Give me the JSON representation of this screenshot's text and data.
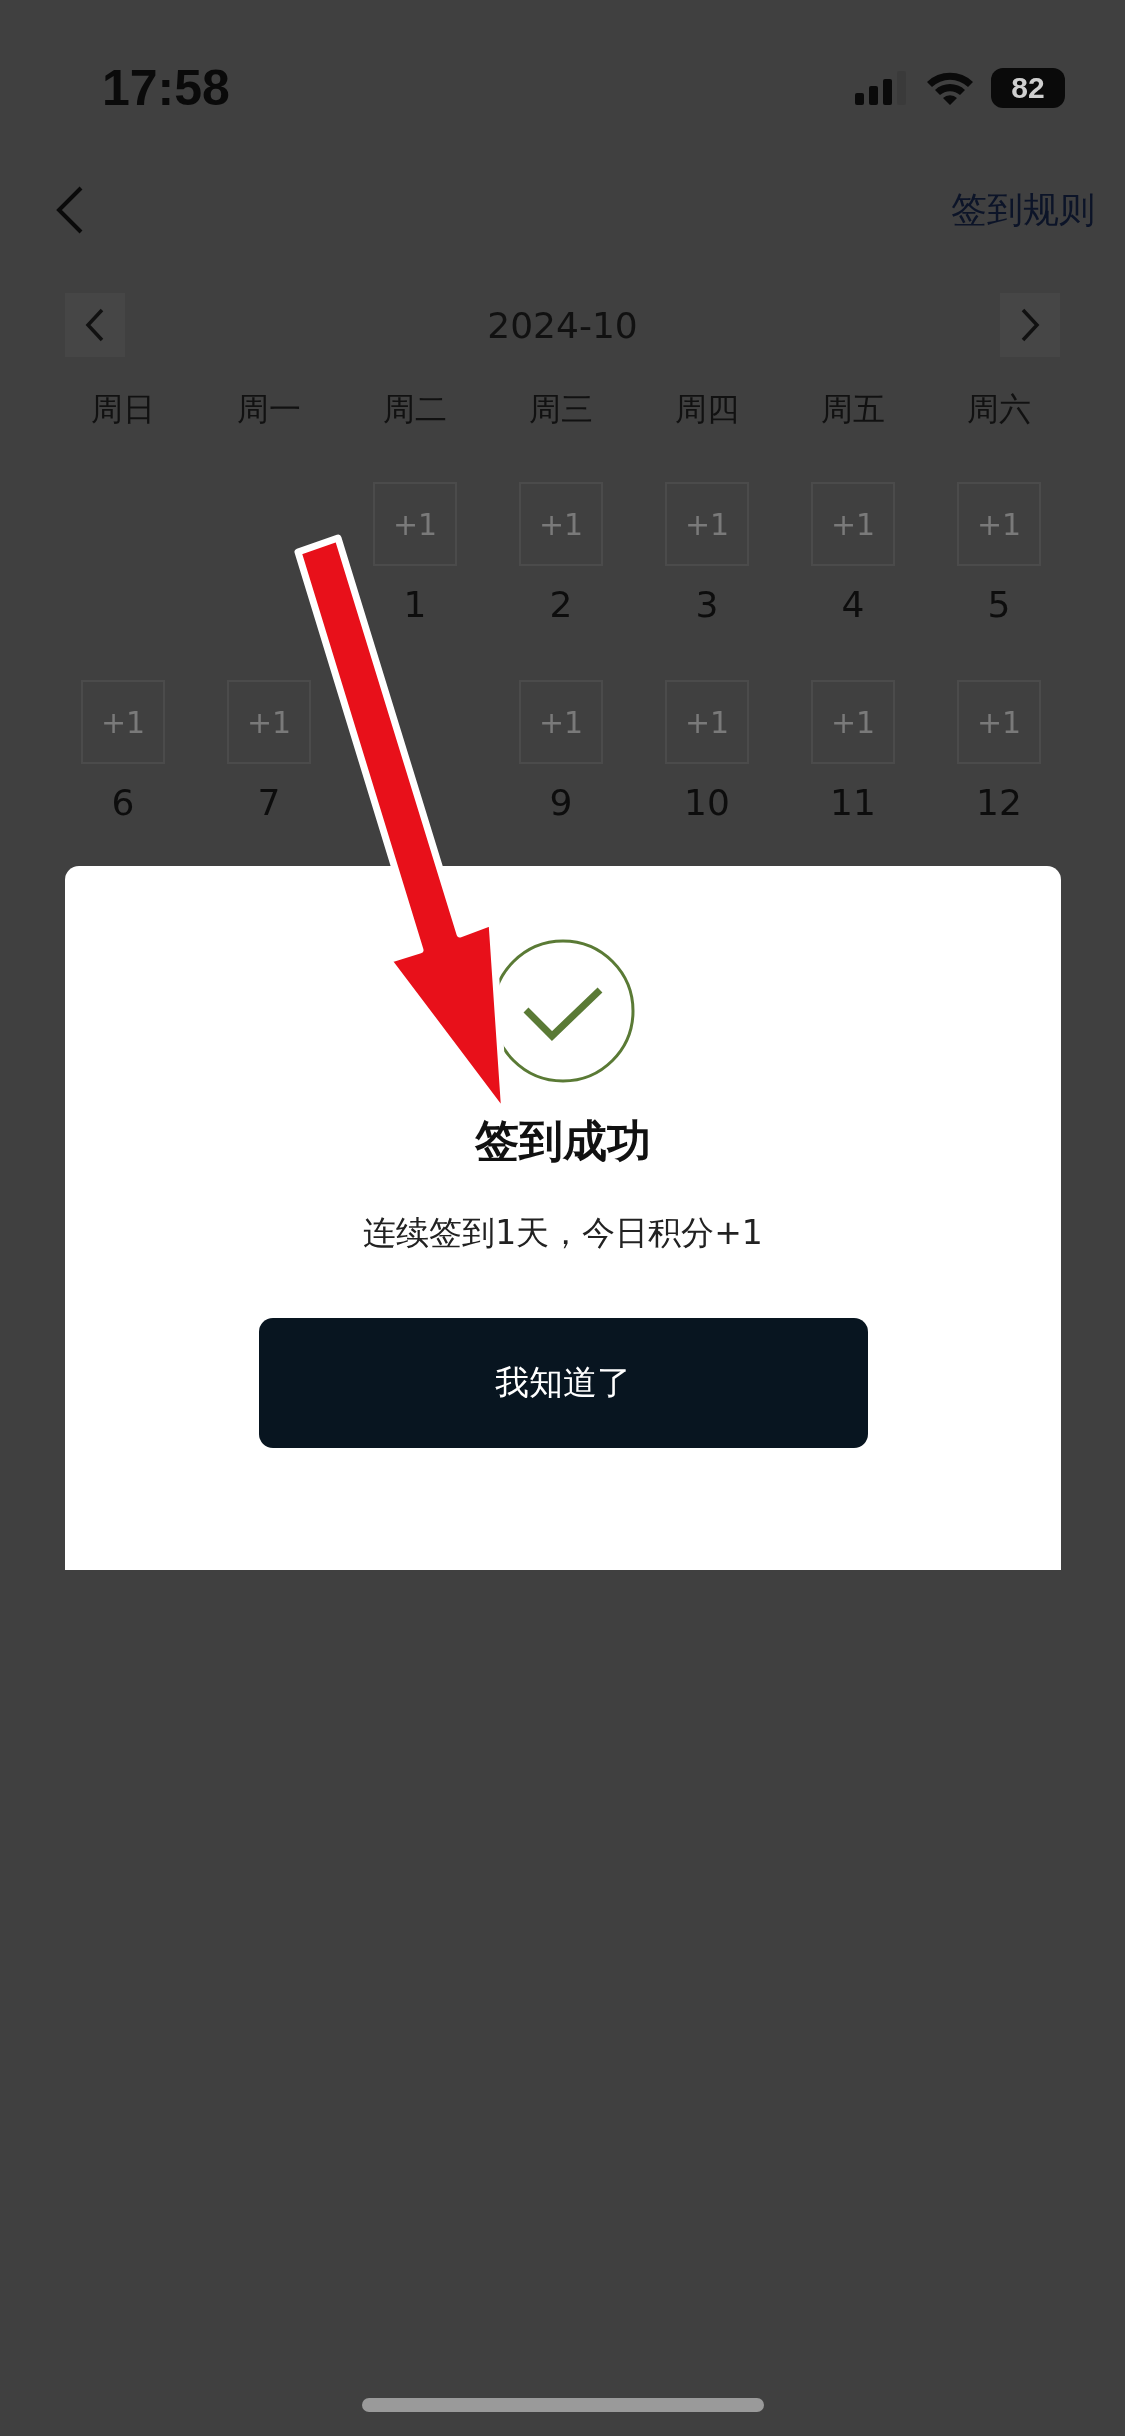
{
  "status_bar": {
    "time": "17:58",
    "battery": "82"
  },
  "nav": {
    "rules_link": "签到规则"
  },
  "calendar": {
    "month": "2024-10",
    "weekdays": [
      "周日",
      "周一",
      "周二",
      "周三",
      "周四",
      "周五",
      "周六"
    ],
    "weeks": [
      [
        {
          "kind": "blank"
        },
        {
          "kind": "blank"
        },
        {
          "kind": "day",
          "bonus": "+1",
          "day": "1"
        },
        {
          "kind": "day",
          "bonus": "+1",
          "day": "2"
        },
        {
          "kind": "day",
          "bonus": "+1",
          "day": "3"
        },
        {
          "kind": "day",
          "bonus": "+1",
          "day": "4"
        },
        {
          "kind": "day",
          "bonus": "+1",
          "day": "5"
        }
      ],
      [
        {
          "kind": "day",
          "bonus": "+1",
          "day": "6"
        },
        {
          "kind": "day",
          "bonus": "+1",
          "day": "7"
        },
        {
          "kind": "covered"
        },
        {
          "kind": "day",
          "bonus": "+1",
          "day": "9"
        },
        {
          "kind": "day",
          "bonus": "+1",
          "day": "10"
        },
        {
          "kind": "day",
          "bonus": "+1",
          "day": "11"
        },
        {
          "kind": "day",
          "bonus": "+1",
          "day": "12"
        }
      ]
    ]
  },
  "dialog": {
    "title": "签到成功",
    "message": "连续签到1天，今日积分+1",
    "button": "我知道了"
  }
}
